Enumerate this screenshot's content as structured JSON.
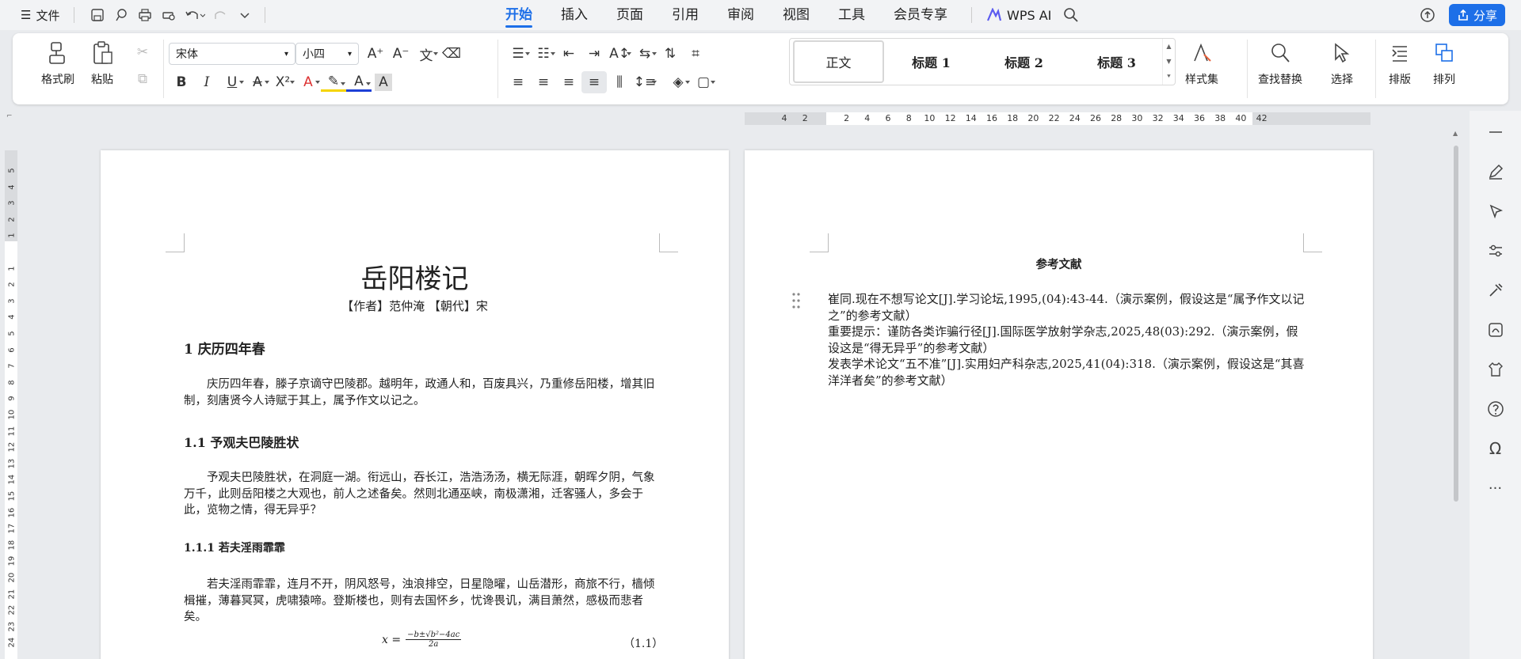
{
  "menubar": {
    "file_label": "文件",
    "tabs": [
      "开始",
      "插入",
      "页面",
      "引用",
      "审阅",
      "视图",
      "工具",
      "会员专享"
    ],
    "active_tab": "开始",
    "wps_ai": "WPS AI",
    "share": "分享",
    "accent": "#1d6fe8"
  },
  "ribbon": {
    "format_painter": "格式刷",
    "paste": "粘贴",
    "font_name": "宋体",
    "font_size": "小四",
    "styles": [
      "正文",
      "标题 1",
      "标题 2",
      "标题 3"
    ],
    "style_set": "样式集",
    "find_replace": "查找替换",
    "select": "选择",
    "layout": "排版",
    "arrange": "排列"
  },
  "hruler": [
    "4",
    "2",
    "",
    "2",
    "4",
    "6",
    "8",
    "10",
    "12",
    "14",
    "16",
    "18",
    "20",
    "22",
    "24",
    "26",
    "28",
    "30",
    "32",
    "34",
    "36",
    "38",
    "40",
    "42"
  ],
  "vruler": [
    "5",
    "4",
    "3",
    "2",
    "1",
    "",
    "1",
    "2",
    "3",
    "4",
    "5",
    "6",
    "7",
    "8",
    "9",
    "10",
    "11",
    "12",
    "13",
    "14",
    "15",
    "16",
    "17",
    "18",
    "19",
    "20",
    "21",
    "22",
    "23",
    "24"
  ],
  "page1": {
    "title": "岳阳楼记",
    "subtitle": "【作者】范仲淹 【朝代】宋",
    "h1": "1 庆历四年春",
    "p1": "庆历四年春，滕子京谪守巴陵郡。越明年，政通人和，百废具兴，乃重修岳阳楼，增其旧制，刻唐贤今人诗赋于其上，属予作文以记之。",
    "h2": "1.1 予观夫巴陵胜状",
    "p2": "予观夫巴陵胜状，在洞庭一湖。衔远山，吞长江，浩浩汤汤，横无际涯，朝晖夕阴，气象万千，此则岳阳楼之大观也，前人之述备矣。然则北通巫峡，南极潇湘，迁客骚人，多会于此，览物之情，得无异乎？",
    "h3": "1.1.1 若夫淫雨霏霏",
    "p3": "若夫淫雨霏霏，连月不开，阴风怒号，浊浪排空，日星隐曜，山岳潜形，商旅不行，樯倾楫摧，薄暮冥冥，虎啸猿啼。登斯楼也，则有去国怀乡，忧谗畏讥，满目萧然，感极而悲者矣。",
    "eq_lhs": "x =",
    "eq_num": "−b±√b²−4ac",
    "eq_den": "2a",
    "eq_no": "（1.1）"
  },
  "page2": {
    "ref_title": "参考文献",
    "refs": "崔同.现在不想写论文[J].学习论坛,1995,(04):43-44.（演示案例，假设这是“属予作文以记之”的参考文献）\n重要提示：谨防各类诈骗行径[J].国际医学放射学杂志,2025,48(03):292.（演示案例，假设这是“得无异乎”的参考文献）\n发表学术论文“五不准”[J].实用妇产科杂志,2025,41(04):318.（演示案例，假设这是“其喜洋洋者矣”的参考文献）"
  }
}
